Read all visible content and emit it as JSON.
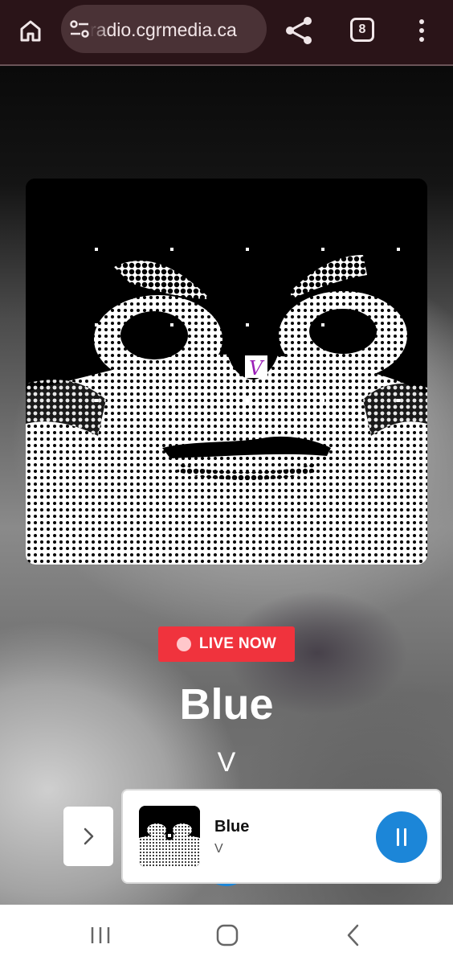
{
  "browser": {
    "url": "radio.cgrmedia.ca",
    "tab_count": "8",
    "icons": {
      "home": "home-icon",
      "site_settings": "tune-icon",
      "share": "share-icon",
      "menu": "more-vert-icon"
    }
  },
  "player": {
    "live_label": "LIVE NOW",
    "title": "Blue",
    "artist": "V",
    "artwork_label": "V",
    "colors": {
      "live_badge": "#f0333d",
      "accent": "#1c86d8",
      "artwork_mark": "#9b1fb8"
    }
  },
  "mini_player": {
    "title": "Blue",
    "artist": "V",
    "expand_icon": "chevron-right-icon",
    "pause_icon": "pause-icon"
  },
  "system_nav": {
    "recents_icon": "recents-icon",
    "home_icon": "home-circle-icon",
    "back_icon": "back-icon"
  }
}
